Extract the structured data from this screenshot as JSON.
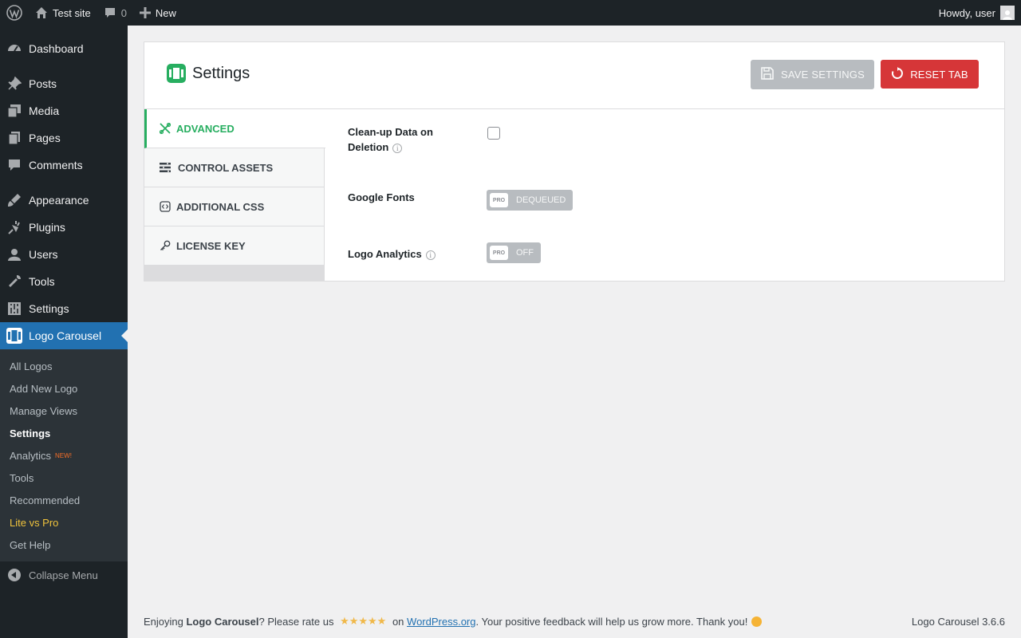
{
  "admin_bar": {
    "site_name": "Test site",
    "comments_count": "0",
    "new_label": "New",
    "greeting": "Howdy, user"
  },
  "sidebar": {
    "items": [
      {
        "label": "Dashboard",
        "icon": "dashboard-icon"
      },
      {
        "label": "Posts",
        "icon": "pin-icon"
      },
      {
        "label": "Media",
        "icon": "media-icon"
      },
      {
        "label": "Pages",
        "icon": "pages-icon"
      },
      {
        "label": "Comments",
        "icon": "comment-icon"
      },
      {
        "label": "Appearance",
        "icon": "brush-icon"
      },
      {
        "label": "Plugins",
        "icon": "plug-icon"
      },
      {
        "label": "Users",
        "icon": "user-icon"
      },
      {
        "label": "Tools",
        "icon": "wrench-icon"
      },
      {
        "label": "Settings",
        "icon": "sliders-icon"
      },
      {
        "label": "Logo Carousel",
        "icon": "carousel-icon"
      }
    ],
    "submenu": [
      {
        "label": "All Logos"
      },
      {
        "label": "Add New Logo"
      },
      {
        "label": "Manage Views"
      },
      {
        "label": "Settings"
      },
      {
        "label": "Analytics",
        "badge": "NEW!"
      },
      {
        "label": "Tools"
      },
      {
        "label": "Recommended"
      },
      {
        "label": "Lite vs Pro"
      },
      {
        "label": "Get Help"
      }
    ],
    "collapse_label": "Collapse Menu"
  },
  "panel": {
    "title": "Settings",
    "save_label": "SAVE SETTINGS",
    "reset_label": "RESET TAB",
    "tabs": [
      {
        "label": "ADVANCED"
      },
      {
        "label": "CONTROL ASSETS"
      },
      {
        "label": "ADDITIONAL CSS"
      },
      {
        "label": "LICENSE KEY"
      }
    ],
    "fields": {
      "cleanup_label_1": "Clean-up Data on",
      "cleanup_label_2": "Deletion",
      "info_glyph": "i",
      "google_fonts_label": "Google Fonts",
      "google_fonts_pro": "PRO",
      "google_fonts_value": "DEQUEUED",
      "logo_analytics_label": "Logo Analytics",
      "logo_analytics_pro": "PRO",
      "logo_analytics_value": "OFF"
    }
  },
  "footer": {
    "text_1": "Enjoying ",
    "plugin_name": "Logo Carousel",
    "text_2": "? Please rate us ",
    "stars": "★★★★★",
    "text_3": " on ",
    "link": "WordPress.org",
    "text_4": ". Your positive feedback will help us grow more. Thank you!",
    "version": "Logo Carousel 3.6.6"
  },
  "colors": {
    "accent": "#2271b1",
    "brand_green": "#27ae60",
    "reset_red": "#d63638",
    "admin_dark": "#1d2327"
  }
}
